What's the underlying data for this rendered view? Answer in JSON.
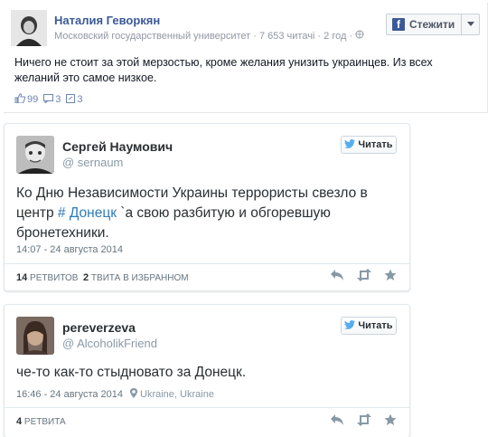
{
  "fb_post": {
    "author": "Наталия Геворкян",
    "meta": "Московский государственный университет · 7 653 читачі · 2 год ·",
    "follow_label": "Стежити",
    "text": "Ничего не стоит за этой мерзостью, кроме желания унизить украинцев. Из всех желаний это самое низкое.",
    "likes": "99",
    "comments": "3",
    "shares": "3"
  },
  "tweets": [
    {
      "name": "Сергей Наумович",
      "handle": "@ sernaum",
      "follow_label": "Читать",
      "text_before": "Ко Дню Независимости Украины террористы свезло в центр ",
      "hashtag": "# Донецк",
      "text_after": " `а свою разбитую и обгоревшую бронетехники.",
      "date": "14:07 - 24 августа 2014",
      "retweets_count": "14",
      "retweets_label": "ретвитов",
      "favorites_count": "2",
      "favorites_label": "твита в избранном"
    },
    {
      "name": "pereverzeva",
      "handle": "@ AlcoholikFriend",
      "follow_label": "Читать",
      "text": "че-то как-то стыдновато за Донецк.",
      "date": "16:46 - 24 августа 2014",
      "location": "Ukraine, Ukraine",
      "retweets_count": "4",
      "retweets_label": "ретвита"
    }
  ],
  "colors": {
    "fb_blue": "#3b5998",
    "twitter_blue": "#55acee",
    "link_blue": "#2b7bb9"
  }
}
